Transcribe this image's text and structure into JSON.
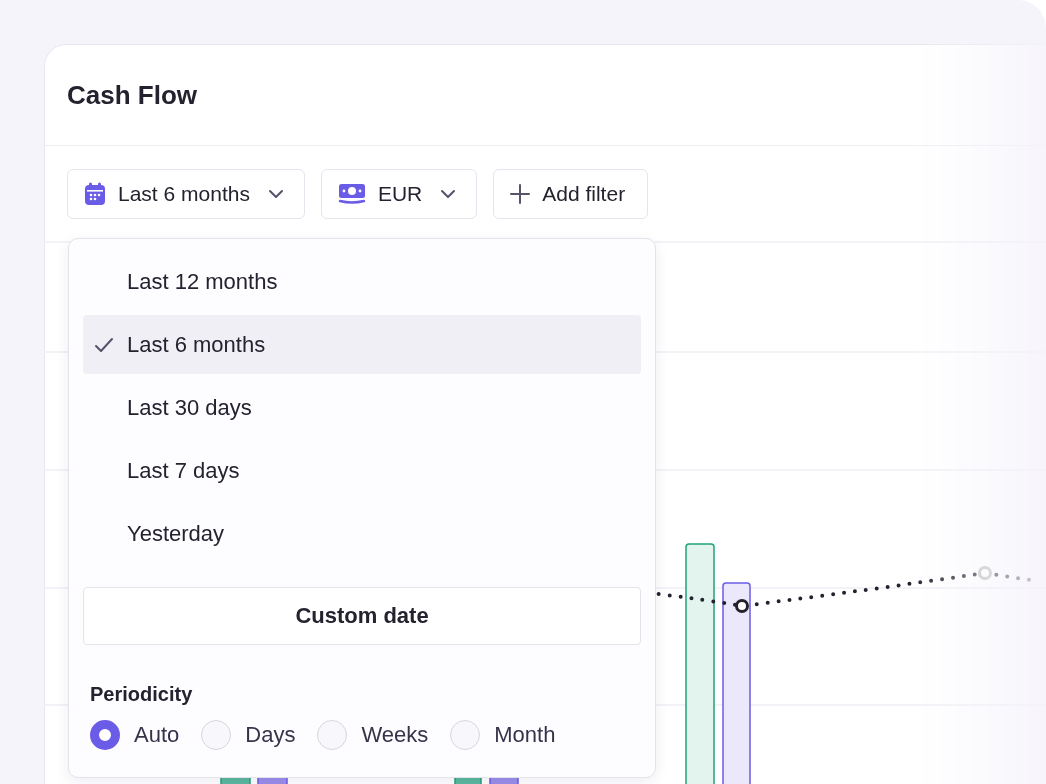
{
  "card": {
    "title": "Cash Flow"
  },
  "filters": [
    {
      "kind": "period",
      "label": "Last 6 months"
    },
    {
      "kind": "currency",
      "label": "EUR"
    },
    {
      "kind": "add",
      "label": "Add filter"
    }
  ],
  "period_menu": {
    "options": [
      {
        "label": "Last 12 months",
        "selected": false
      },
      {
        "label": "Last 6 months",
        "selected": true
      },
      {
        "label": "Last 30 days",
        "selected": false
      },
      {
        "label": "Last 7 days",
        "selected": false
      },
      {
        "label": "Yesterday",
        "selected": false
      }
    ],
    "custom_button": "Custom date",
    "periodicity": {
      "label": "Periodicity",
      "options": [
        {
          "label": "Auto",
          "selected": true
        },
        {
          "label": "Days",
          "selected": false
        },
        {
          "label": "Weeks",
          "selected": false
        },
        {
          "label": "Month",
          "selected": false
        }
      ]
    }
  }
}
